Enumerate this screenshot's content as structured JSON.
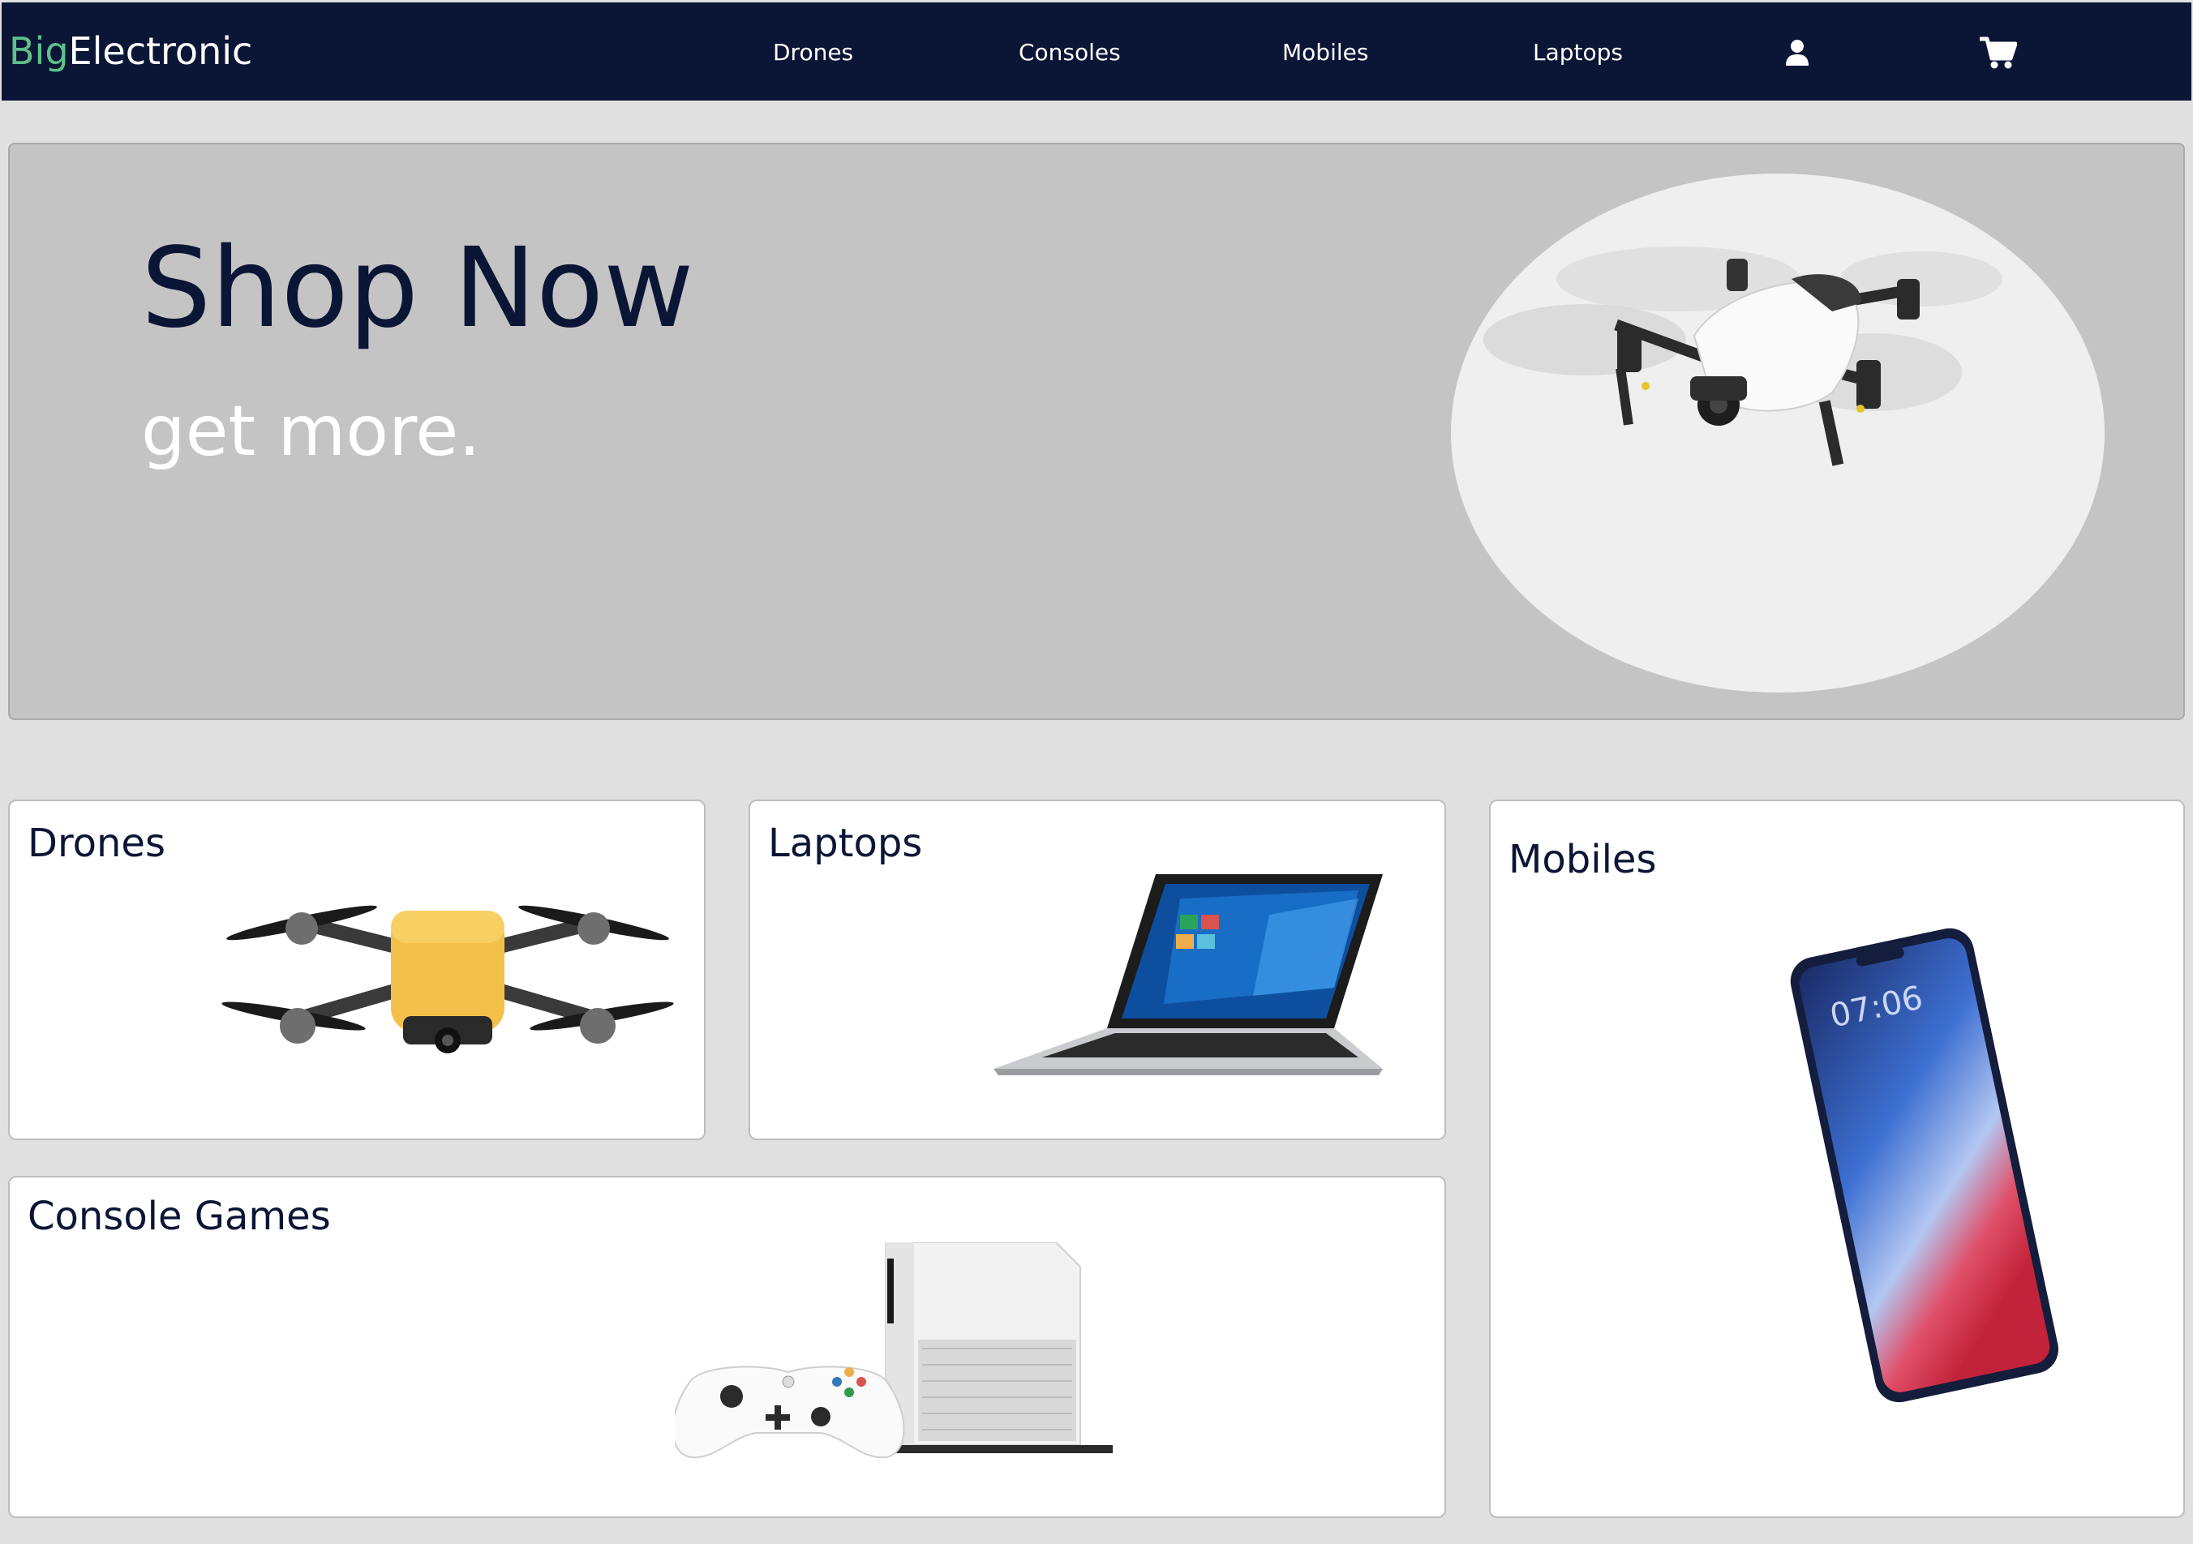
{
  "brand": {
    "prefix": "Big",
    "suffix": "Electronic",
    "prefix_color": "#5dc08a"
  },
  "nav": {
    "links": [
      "Drones",
      "Consoles",
      "Mobiles",
      "Laptops"
    ],
    "user_icon": "user-icon",
    "cart_icon": "shopping-cart-icon",
    "background": "#0b1535"
  },
  "hero": {
    "title": "Shop Now",
    "subtitle": "get more.",
    "image": "white-drone"
  },
  "categories": [
    {
      "title": "Drones",
      "image": "yellow-drone"
    },
    {
      "title": "Laptops",
      "image": "laptop"
    },
    {
      "title": "Mobiles",
      "image": "smartphone"
    },
    {
      "title": "Console Games",
      "image": "game-console-with-controller"
    }
  ],
  "colors": {
    "page_background": "#e0e0e0",
    "hero_background": "#c4c4c4",
    "text_dark": "#0b1535"
  }
}
